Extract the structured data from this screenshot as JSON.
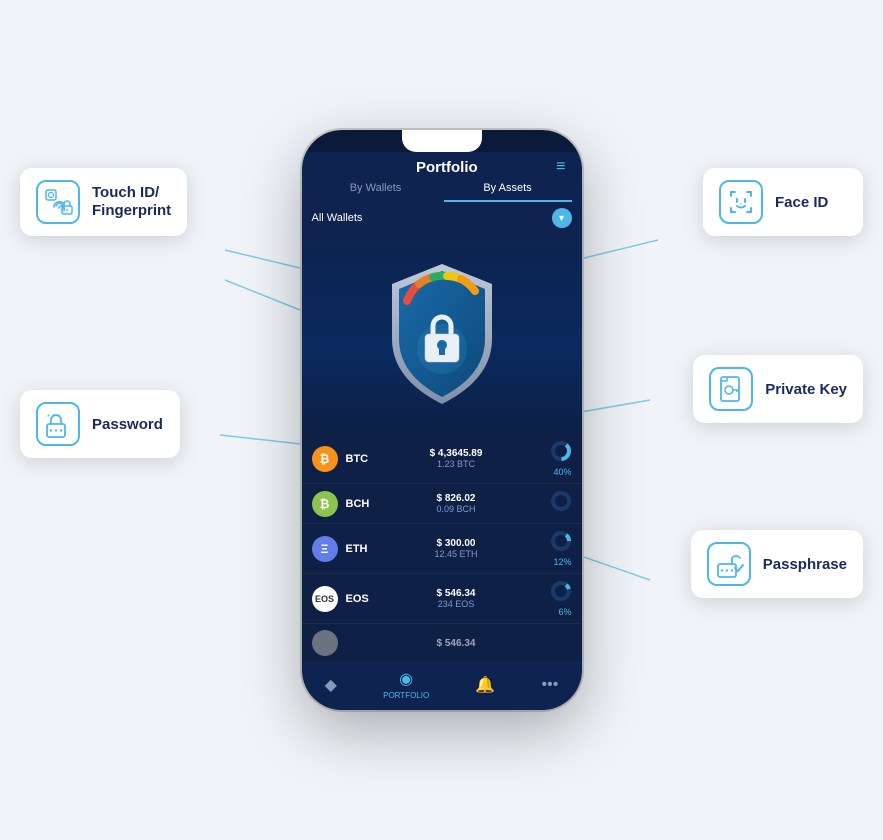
{
  "header": {
    "title": "Portfolio",
    "hamburger": "≡"
  },
  "tabs": [
    {
      "label": "By Wallets",
      "active": false
    },
    {
      "label": "By Assets",
      "active": true
    }
  ],
  "dropdown": {
    "text": "All Wallets",
    "icon": "▾"
  },
  "cryptos": [
    {
      "name": "BTC",
      "usd": "$ 4,3645.89",
      "amount": "1.23 BTC",
      "percent": "40%",
      "iconClass": "btc-icon",
      "iconText": "₿"
    },
    {
      "name": "BCH",
      "usd": "$ 826.02",
      "amount": "0.09 BCH",
      "percent": "",
      "iconClass": "bch-icon",
      "iconText": "₿"
    },
    {
      "name": "ETH",
      "usd": "$ 300.00",
      "amount": "12.45 ETH",
      "percent": "12%",
      "iconClass": "eth-icon",
      "iconText": "Ξ"
    },
    {
      "name": "EOS",
      "usd": "$ 546.34",
      "amount": "234 EOS",
      "percent": "6%",
      "iconClass": "eos-icon",
      "iconText": "E"
    },
    {
      "name": "",
      "usd": "$ 546.34",
      "amount": "",
      "percent": "",
      "iconClass": "other-icon",
      "iconText": ""
    }
  ],
  "nav": [
    {
      "icon": "◆",
      "label": "",
      "active": false
    },
    {
      "icon": "◉",
      "label": "PORTFOLIO",
      "active": true
    },
    {
      "icon": "🔔",
      "label": "",
      "active": false
    },
    {
      "icon": "•••",
      "label": "",
      "active": false
    }
  ],
  "features": [
    {
      "id": "touch-id",
      "label": "Touch ID/\nFingerprint",
      "label_line1": "Touch ID/",
      "label_line2": "Fingerprint"
    },
    {
      "id": "face-id",
      "label": "Face ID"
    },
    {
      "id": "password",
      "label": "Password"
    },
    {
      "id": "private-key",
      "label": "Private Key"
    },
    {
      "id": "passphrase",
      "label": "Passphrase"
    }
  ],
  "colors": {
    "accent": "#4db8e8",
    "dark_bg": "#0a1a3a",
    "card_border": "#4db8e8"
  }
}
